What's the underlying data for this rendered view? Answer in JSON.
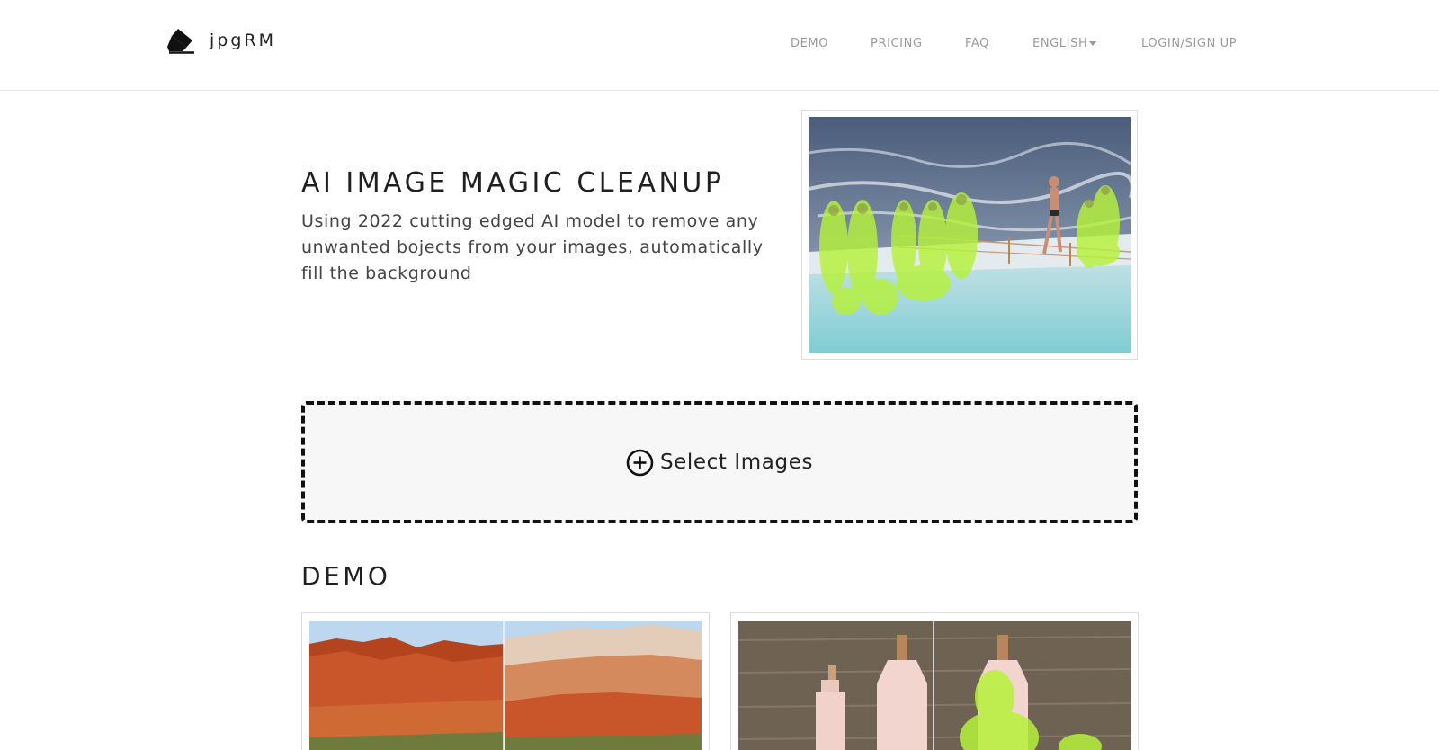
{
  "brand": {
    "name": "jpgRM",
    "icon": "eraser-icon"
  },
  "nav": {
    "demo": "DEMO",
    "pricing": "PRICING",
    "faq": "FAQ",
    "language": "ENGLISH",
    "login": "LOGIN/SIGN UP"
  },
  "hero": {
    "title": "AI IMAGE MAGIC CLEANUP",
    "description": "Using 2022 cutting edged AI model to remove any unwanted bojects from your images, automatically fill the background"
  },
  "upload": {
    "label": "Select Images",
    "icon": "plus-circle-icon"
  },
  "demo": {
    "title": "DEMO"
  },
  "colors": {
    "nav_text": "#9a9a9a",
    "heading": "#1f1f1f",
    "mask_highlight": "#b6f23a",
    "dropzone_border": "#111111",
    "dropzone_bg": "#f7f7f7"
  }
}
